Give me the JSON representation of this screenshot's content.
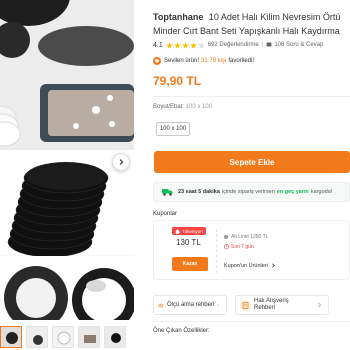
{
  "product": {
    "brand": "Toptanhane",
    "title_line1": "10 Adet Halı Kilim Nevresim Örtü",
    "title_line2": "Minder Cırt Bant Seti Yapışkanlı Halı Kaydırma",
    "rating": "4.1",
    "stars_filled": 4,
    "stars_total": 5,
    "reviews": "692 Değerlendirme",
    "qa": "106 Soru & Cevap",
    "fav_prefix": "Sevilen ürün!",
    "fav_count": "31.78 kişi",
    "fav_suffix": "favoriledi!",
    "price": "79,90 TL"
  },
  "size": {
    "label": "Boyut/Ebat:",
    "value": "100 x 100",
    "options": [
      "100 x 100"
    ]
  },
  "cart": {
    "label": "Sepete Ekle"
  },
  "shipping": {
    "time": "23 saat 5 dakika",
    "middle": "içinde sipariş verirsen",
    "fast": "en geç yarın",
    "suffix": "kargoda!"
  },
  "coupons": {
    "title": "Kuponlar",
    "badge": "Tükeniyor!",
    "amount": "130 TL",
    "claim": "Kazan",
    "condition": "Alt Limit 1250 TL",
    "deadline": "Son 7 gün",
    "products_link": "Kupon'un Ürünleri"
  },
  "guides": [
    {
      "label": "Ölçü alma rehberi"
    },
    {
      "label_line1": "Halı Alışveriş",
      "label_line2": "Rehberi"
    }
  ],
  "featured_title": "Öne Çıkan Özellikler:",
  "colors": {
    "accent": "#f27a1a",
    "star": "#ffc000",
    "success": "#0bc15c",
    "danger": "#f84444"
  },
  "icons": {
    "gallery_next": "chevron-right-icon",
    "favorite": "heart-icon",
    "shipping": "truck-icon",
    "badge": "fire-icon",
    "deadline": "clock-icon",
    "guide_measure": "ruler-icon",
    "guide_rug": "book-icon"
  }
}
